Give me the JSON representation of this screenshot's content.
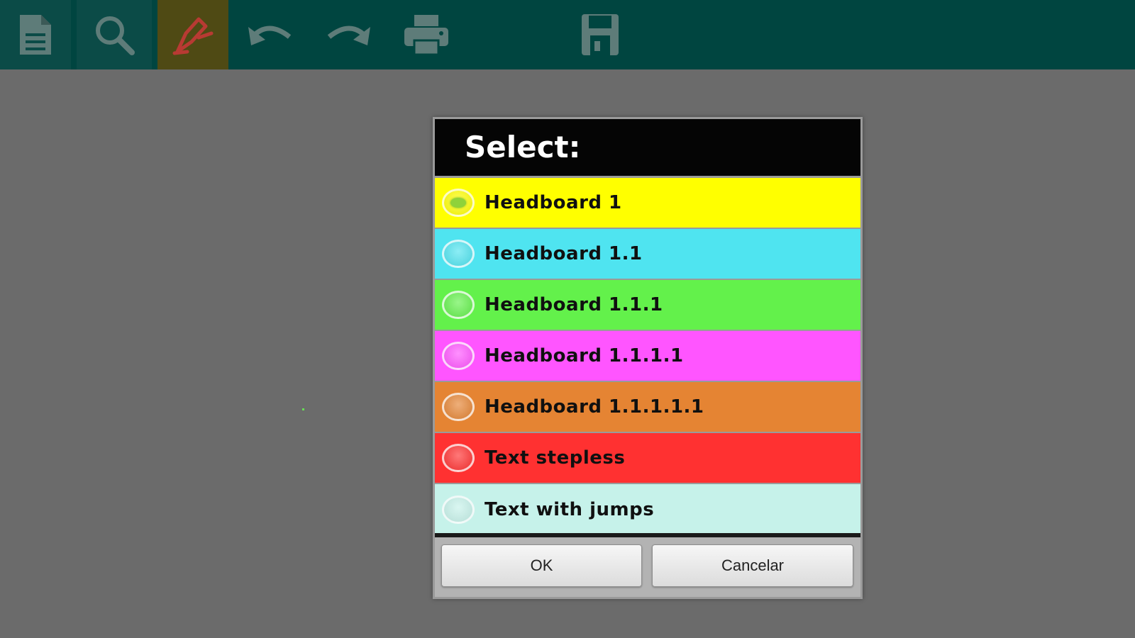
{
  "toolbar": {
    "buttons": [
      {
        "icon": "document-icon"
      },
      {
        "icon": "search-icon"
      },
      {
        "icon": "highlighter-pen-icon"
      },
      {
        "icon": "undo-icon"
      },
      {
        "icon": "redo-icon"
      },
      {
        "icon": "print-icon"
      },
      {
        "icon": "save-icon"
      }
    ],
    "colors": {
      "background": "#004540",
      "icon": "#5e7c79",
      "pen_icon": "#b83a33",
      "active_bg": "#4f4a14"
    }
  },
  "dialog": {
    "title": "Select:",
    "options": [
      {
        "label": "Headboard 1",
        "color": "#ffff00",
        "checked": true
      },
      {
        "label": "Headboard 1.1",
        "color": "#4fe4f0",
        "checked": false
      },
      {
        "label": "Headboard 1.1.1",
        "color": "#63f14b",
        "checked": false
      },
      {
        "label": "Headboard 1.1.1.1",
        "color": "#ff55ff",
        "checked": false
      },
      {
        "label": "Headboard 1.1.1.1.1",
        "color": "#e58433",
        "checked": false
      },
      {
        "label": "Text stepless",
        "color": "#ff3131",
        "checked": false
      },
      {
        "label": "Text with jumps",
        "color": "#c6f2ea",
        "checked": false
      }
    ],
    "ok_label": "OK",
    "cancel_label": "Cancelar"
  }
}
